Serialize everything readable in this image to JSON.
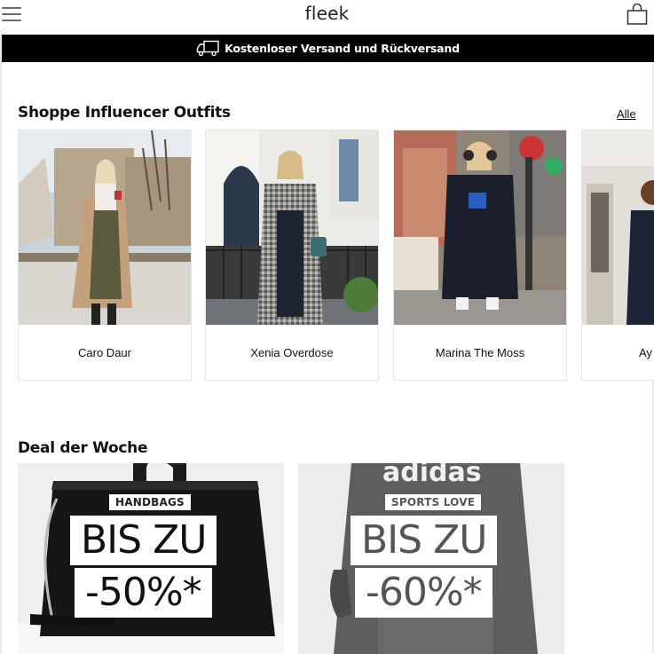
{
  "header": {
    "logo": "fleek",
    "menu_icon": "hamburger-menu-icon",
    "cart_icon": "shopping-bag-icon"
  },
  "banner": {
    "icon": "delivery-truck-icon",
    "text": "Kostenloser Versand und Rückversand"
  },
  "influencers": {
    "title": "Shoppe Influencer Outfits",
    "see_all": "Alle",
    "items": [
      {
        "name": "Caro Daur"
      },
      {
        "name": "Xenia Overdose"
      },
      {
        "name": "Marina The Moss"
      },
      {
        "name": "Ay"
      }
    ]
  },
  "deals": {
    "title": "Deal der Woche",
    "items": [
      {
        "tag": "HANDBAGS",
        "line1": "BIS ZU",
        "line2": "-50%*"
      },
      {
        "tag": "SPORTS LOVE",
        "line1": "BIS ZU",
        "line2": "-60%*"
      }
    ]
  },
  "colors": {
    "banner_bg": "#000000",
    "banner_text": "#ffffff",
    "card_border": "#e6e6e6"
  }
}
